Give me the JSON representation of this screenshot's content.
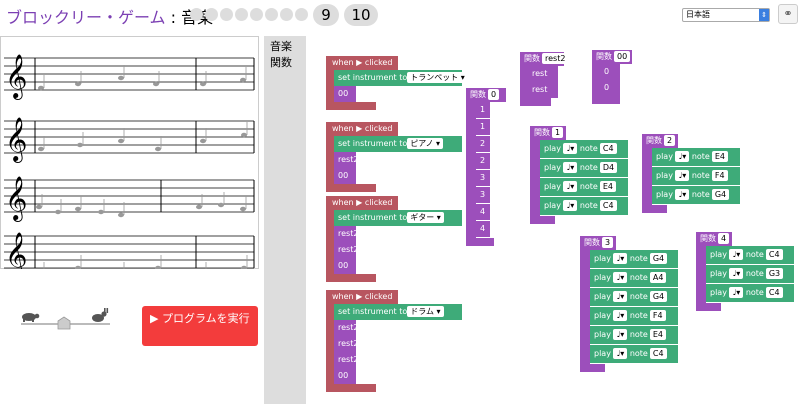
{
  "header": {
    "app_title": "ブロックリー・ゲーム",
    "separator": " : ",
    "game_name": "音楽",
    "levels_completed": 8,
    "level_9": "9",
    "level_10": "10",
    "language": "日本語"
  },
  "run_button": {
    "icon": "play-icon",
    "label": "▶ プログラムを実行"
  },
  "toolbox": {
    "categories": [
      "音楽",
      "関数"
    ]
  },
  "blocks": {
    "when_clicked": "when ▶ clicked",
    "set_instrument": "set instrument to",
    "play": "play",
    "note": "note",
    "function_prefix": "関数",
    "rest": "rest",
    "rest2": "rest2",
    "func00": "00"
  },
  "instruments": [
    "トランペット",
    "ピアノ",
    "ギター",
    "ドラム"
  ],
  "main_stacks": [
    {
      "instrument": "トランペット",
      "calls": [
        "00"
      ]
    },
    {
      "instrument": "ピアノ",
      "calls": [
        "rest2",
        "00"
      ]
    },
    {
      "instrument": "ギター",
      "calls": [
        "rest2",
        "rest2",
        "00"
      ]
    },
    {
      "instrument": "ドラム",
      "calls": [
        "rest2",
        "rest2",
        "rest2",
        "00"
      ]
    }
  ],
  "func_rest2": {
    "name": "rest2",
    "body": [
      "rest",
      "rest"
    ]
  },
  "func_00": {
    "name": "00",
    "body": [
      "0",
      "0"
    ]
  },
  "func_0": {
    "name": "0",
    "body": [
      "1",
      "1",
      "2",
      "2",
      "3",
      "3",
      "4",
      "4"
    ]
  },
  "func_1": {
    "name": "1",
    "notes": [
      "C4",
      "D4",
      "E4",
      "C4"
    ]
  },
  "func_2": {
    "name": "2",
    "notes": [
      "E4",
      "F4",
      "G4"
    ]
  },
  "func_3": {
    "name": "3",
    "notes": [
      "G4",
      "A4",
      "G4",
      "F4",
      "E4",
      "C4"
    ]
  },
  "func_4": {
    "name": "4",
    "notes": [
      "C4",
      "G3",
      "C4"
    ]
  }
}
